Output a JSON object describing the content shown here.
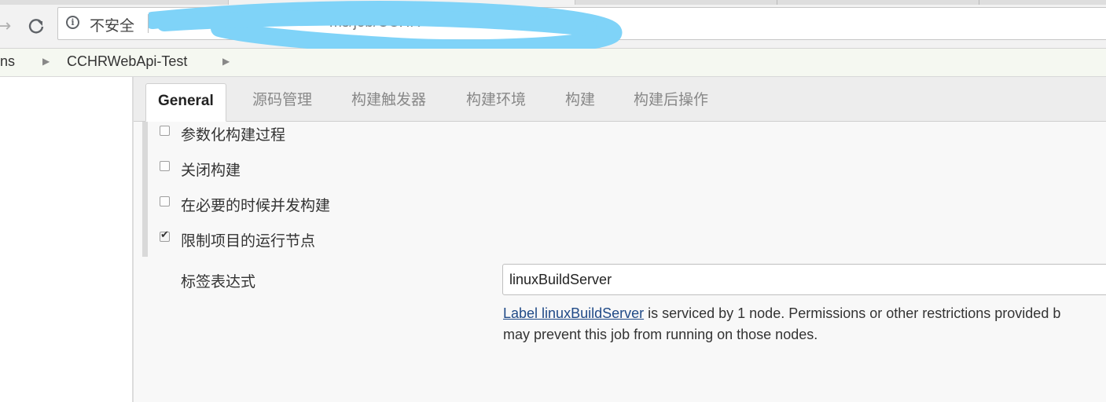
{
  "browser": {
    "security_label": "不安全",
    "url_fragment": "ms/job/CCHR"
  },
  "breadcrumb": {
    "items": [
      "ns",
      "CCHRWebApi-Test"
    ]
  },
  "config": {
    "tabs": [
      "General",
      "源码管理",
      "构建触发器",
      "构建环境",
      "构建",
      "构建后操作"
    ],
    "active_tab": "General",
    "options": [
      {
        "label": "参数化构建过程",
        "checked": false
      },
      {
        "label": "关闭构建",
        "checked": false
      },
      {
        "label": "在必要的时候并发构建",
        "checked": false
      },
      {
        "label": "限制项目的运行节点",
        "checked": true
      }
    ],
    "label_expression": {
      "label": "标签表达式",
      "value": "linuxBuildServer",
      "help_link": "Label linuxBuildServer",
      "help_line1_rest": " is serviced by 1 node. Permissions or other restrictions provided b",
      "help_line2": "may prevent this job from running on those nodes."
    }
  },
  "colors": {
    "redaction": "#7fd3f8",
    "link": "#204a87"
  }
}
